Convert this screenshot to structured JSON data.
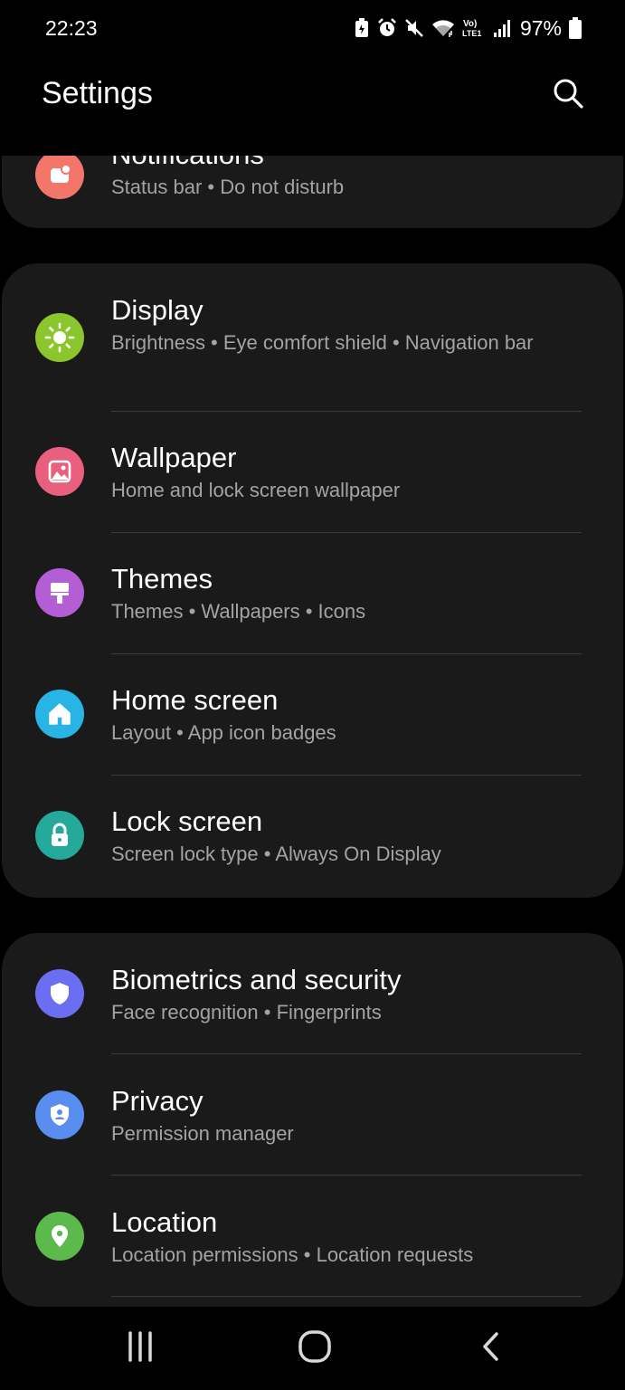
{
  "status_bar": {
    "time": "22:23",
    "battery_pct": "97%",
    "icons": [
      "battery-saver-icon",
      "alarm-icon",
      "mute-icon",
      "wifi-icon",
      "volte-lte-icon",
      "signal-icon",
      "battery-icon"
    ]
  },
  "header": {
    "title": "Settings",
    "search_icon": "search-icon"
  },
  "groups": [
    {
      "items": [
        {
          "title": "Notifications",
          "subtitle": "Status bar  •  Do not disturb",
          "icon": "notifications-icon",
          "color": "#f2776a"
        }
      ]
    },
    {
      "items": [
        {
          "title": "Display",
          "subtitle": "Brightness  •  Eye comfort shield  •  Navigation bar",
          "icon": "sun-icon",
          "color": "#8bc72c"
        },
        {
          "title": "Wallpaper",
          "subtitle": "Home and lock screen wallpaper",
          "icon": "image-icon",
          "color": "#e9607e"
        },
        {
          "title": "Themes",
          "subtitle": "Themes  •  Wallpapers  •  Icons",
          "icon": "brush-icon",
          "color": "#b45ed6"
        },
        {
          "title": "Home screen",
          "subtitle": "Layout  •  App icon badges",
          "icon": "home-icon",
          "color": "#28b4e4"
        },
        {
          "title": "Lock screen",
          "subtitle": "Screen lock type  •  Always On Display",
          "icon": "lock-icon",
          "color": "#24a99a"
        }
      ]
    },
    {
      "items": [
        {
          "title": "Biometrics and security",
          "subtitle": "Face recognition  •  Fingerprints",
          "icon": "shield-icon",
          "color": "#6b6ef0"
        },
        {
          "title": "Privacy",
          "subtitle": "Permission manager",
          "icon": "privacy-shield-icon",
          "color": "#5a8df0"
        },
        {
          "title": "Location",
          "subtitle": "Location permissions  •  Location requests",
          "icon": "location-pin-icon",
          "color": "#5cba4d"
        }
      ]
    }
  ],
  "nav_bar": {
    "recents_icon": "recents-icon",
    "home_icon": "home-button-icon",
    "back_icon": "back-icon"
  }
}
